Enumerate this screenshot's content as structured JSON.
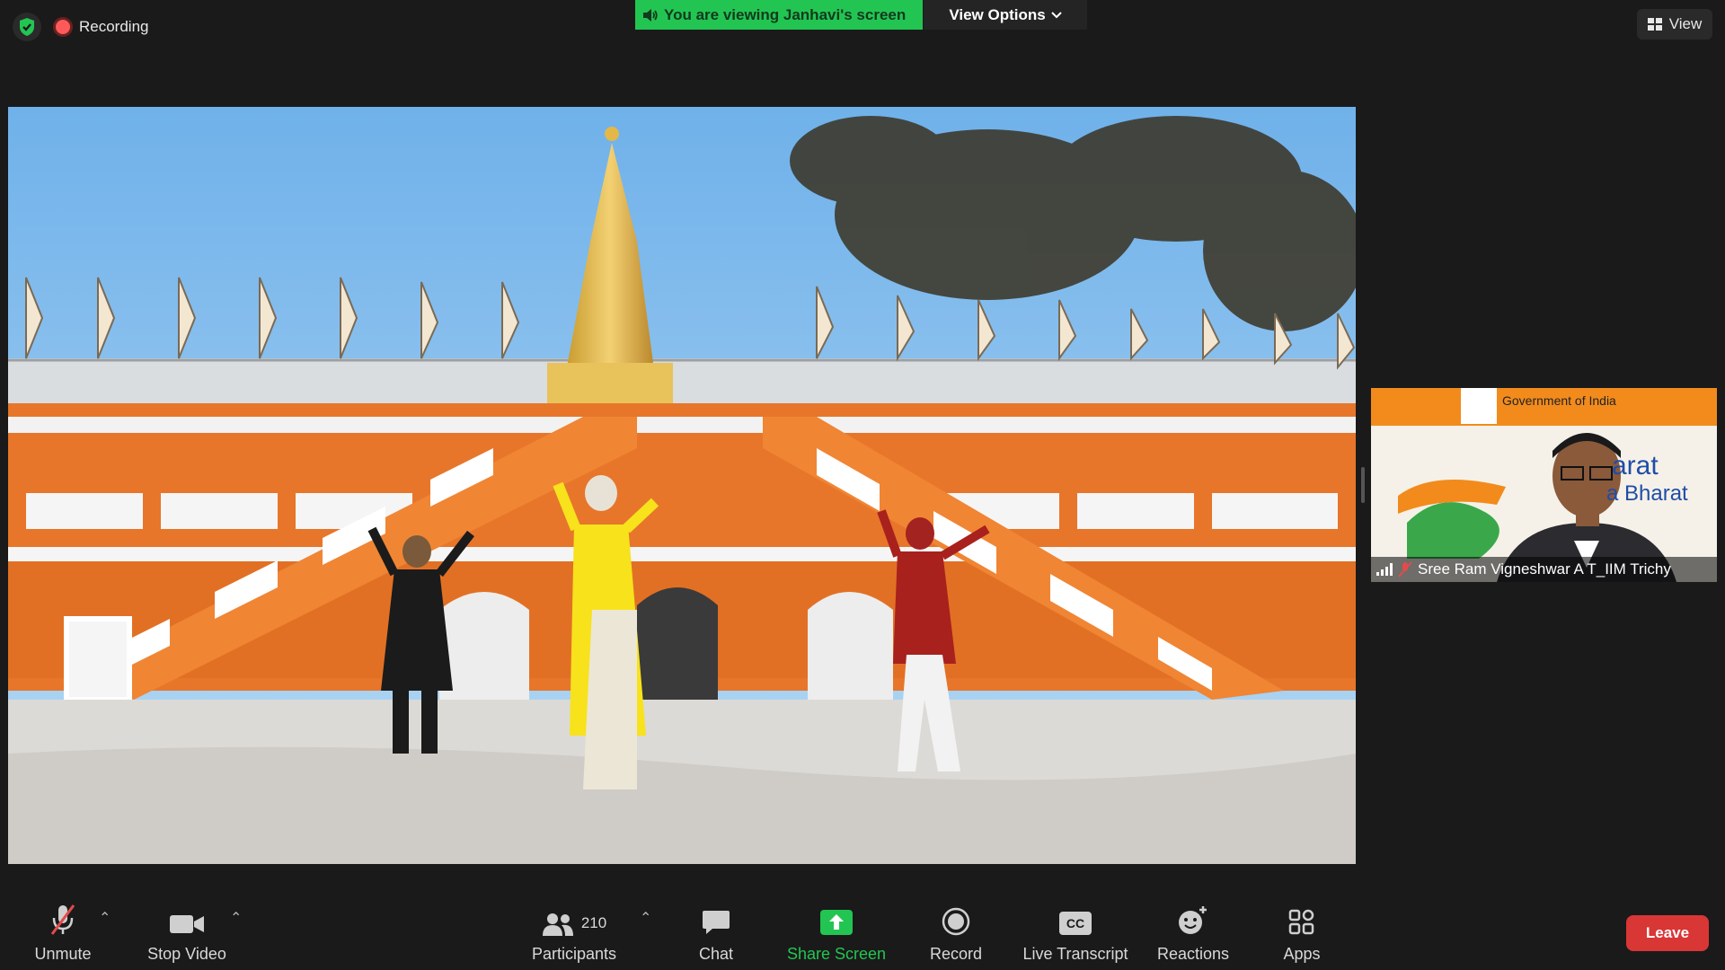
{
  "top_bar": {
    "recording_label": "Recording",
    "viewing_banner": "You are viewing Janhavi's screen",
    "view_options_label": "View Options",
    "view_label": "View"
  },
  "participant_tile": {
    "name": "Sree Ram Vigneshwar A T_IIM Trichy",
    "background_text_top": "Government of India",
    "background_text_mid1": "arat",
    "background_text_mid2": "a Bharat"
  },
  "toolbar": {
    "unmute_label": "Unmute",
    "stop_video_label": "Stop Video",
    "participants_label": "Participants",
    "participants_count": "210",
    "chat_label": "Chat",
    "share_screen_label": "Share Screen",
    "record_label": "Record",
    "live_transcript_label": "Live Transcript",
    "reactions_label": "Reactions",
    "apps_label": "Apps",
    "leave_label": "Leave"
  },
  "colors": {
    "viewing_banner": "#23c552",
    "share_screen_icon": "#23c552",
    "leave_button": "#d93636",
    "recording_dot": "#ff5a5a",
    "temple_orange": "#e7762a"
  },
  "icons": [
    "shield-check-icon",
    "recording-dot-icon",
    "speaker-icon",
    "chevron-down-icon",
    "grid-view-icon",
    "muted-mic-icon",
    "video-camera-icon",
    "participants-icon",
    "chat-bubble-icon",
    "share-arrow-icon",
    "record-circle-icon",
    "cc-icon",
    "smiley-plus-icon",
    "apps-icon"
  ]
}
